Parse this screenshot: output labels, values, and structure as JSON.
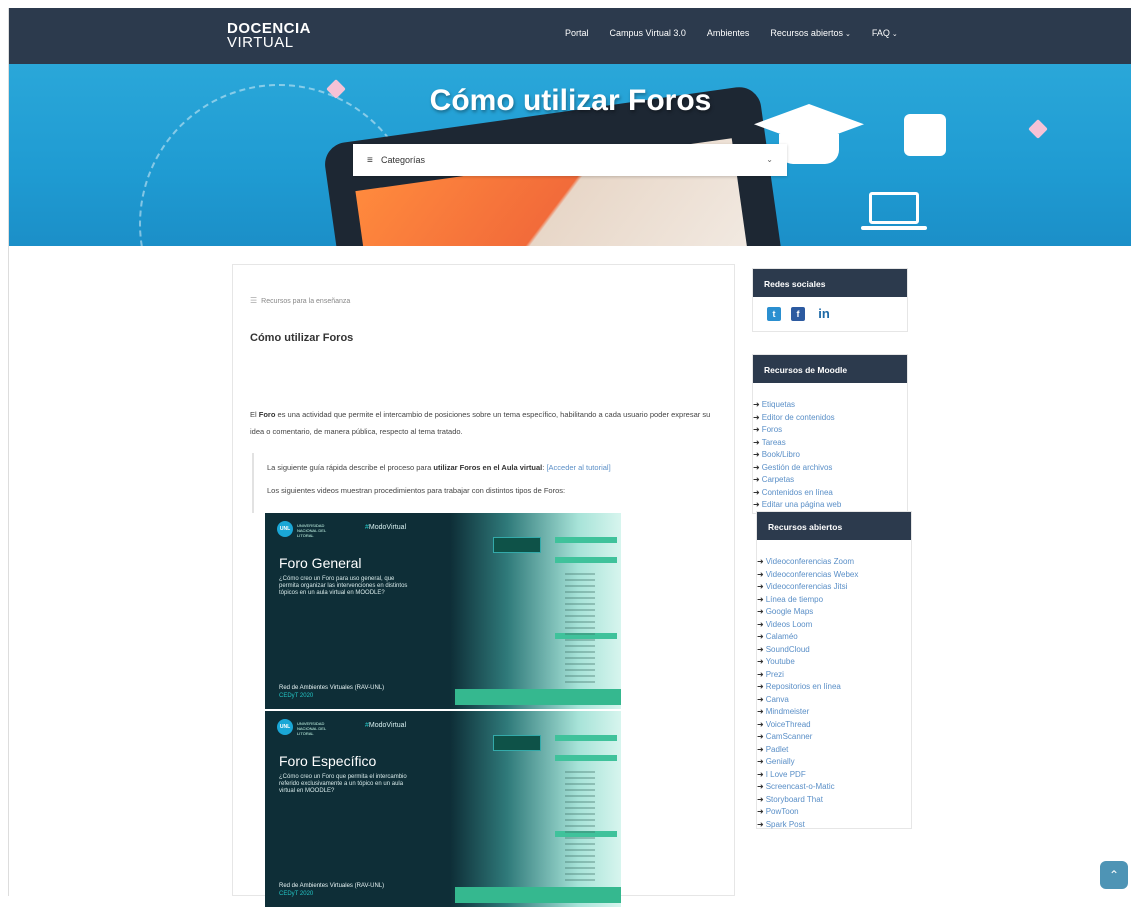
{
  "header": {
    "logo_line1": "DOCENCIA",
    "logo_line2": "VIRTUAL",
    "nav": [
      {
        "label": "Portal"
      },
      {
        "label": "Campus Virtual 3.0"
      },
      {
        "label": "Ambientes"
      },
      {
        "label": "Recursos abiertos",
        "caret": "⌄"
      },
      {
        "label": "FAQ",
        "caret": "⌄"
      }
    ]
  },
  "hero": {
    "title": "Cómo utilizar Foros",
    "categories_label": "Categorías",
    "categories_chevron": "⌄"
  },
  "post": {
    "breadcrumb": "Recursos para la enseñanza",
    "title": "Cómo utilizar Foros",
    "intro_pre": "El ",
    "intro_bold": "Foro",
    "intro_post": " es una actividad que permite el intercambio de posiciones sobre un tema específico, habilitando a cada usuario poder expresar su idea o comentario, de manera pública, respecto al tema tratado.",
    "quote_pre": "La siguiente guía rápida describe el proceso para ",
    "quote_bold": "utilizar Foros en el Aula virtual",
    "quote_colon": ": ",
    "quote_link": "[Acceder al tutorial]",
    "quote_line2": "Los siguientes videos muestran procedimientos para trabajar con distintos tipos de Foros:"
  },
  "videos": [
    {
      "uni": "UNL",
      "uni_txt": "UNIVERSIDAD NACIONAL DEL LITORAL",
      "hash": "#",
      "tag": "ModoVirtual",
      "title": "Foro General",
      "desc": "¿Cómo creo un Foro para uso general, que permita organizar las intervenciones en distintos tópicos en un aula virtual en MOODLE?",
      "footer1": "Red de Ambientes Virtuales (RAV-UNL)",
      "footer2": "CEDyT 2020"
    },
    {
      "uni": "UNL",
      "uni_txt": "UNIVERSIDAD NACIONAL DEL LITORAL",
      "hash": "#",
      "tag": "ModoVirtual",
      "title": "Foro Específico",
      "desc": "¿Cómo creo un Foro que permita el intercambio referido exclusivamente a un tópico en un aula virtual en MOODLE?",
      "footer1": "Red de Ambientes Virtuales (RAV-UNL)",
      "footer2": "CEDyT 2020"
    }
  ],
  "sidebar": {
    "social_title": "Redes sociales",
    "moodle_title": "Recursos de Moodle",
    "moodle_items": [
      "Etiquetas",
      "Editor de contenidos",
      "Foros",
      "Tareas",
      "Book/Libro",
      "Gestión de archivos",
      "Carpetas",
      "Contenidos en línea",
      "Editar una página web"
    ],
    "open_title": "Recursos abiertos",
    "open_items": [
      "Videoconferencias Zoom",
      "Videoconferencias Webex",
      "Videoconferencias Jitsi",
      "Línea de tiempo",
      "Google Maps",
      "Videos Loom",
      "Calaméo",
      "SoundCloud",
      "Youtube",
      "Prezi",
      "Repositorios en línea",
      "Canva",
      "Mindmeister",
      "VoiceThread",
      "CamScanner",
      "Padlet",
      "Genially",
      "I Love PDF",
      "Screencast-o-Matic",
      "Storyboard That",
      "PowToon",
      "Spark Post"
    ]
  },
  "icons": {
    "twitter": "twitter-icon",
    "facebook": "facebook-icon",
    "linkedin": "linkedin-icon",
    "menu": "hamburger-icon",
    "scroll_top": "chevron-up-icon"
  },
  "colors": {
    "header_bg": "#2c3a4d",
    "hero_bg": "#1f9bd2",
    "link": "#5a8fc7",
    "scroll_top": "#4e94b5"
  }
}
